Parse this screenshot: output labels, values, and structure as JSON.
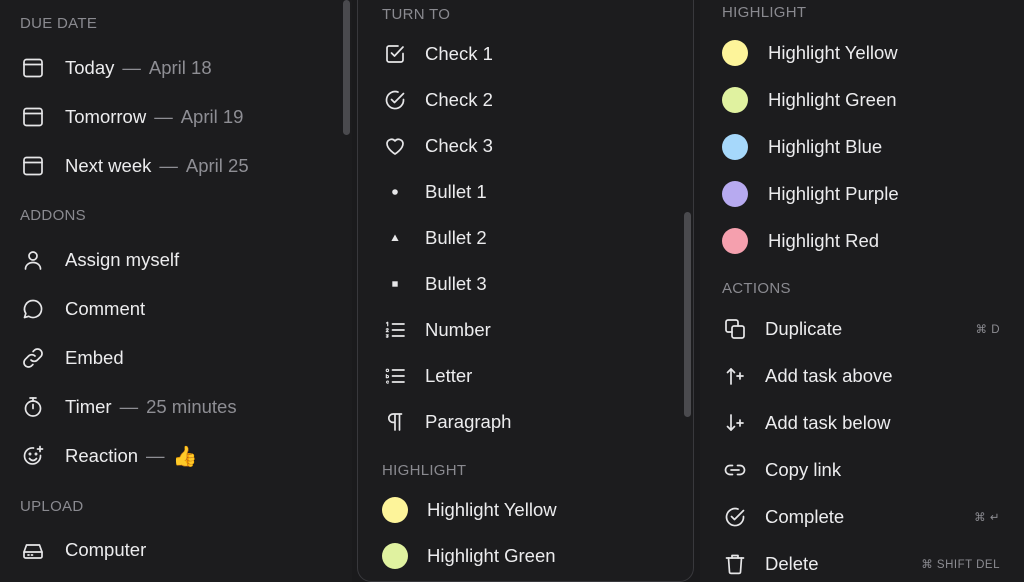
{
  "left": {
    "due_header": "DUE DATE",
    "due": [
      {
        "label": "Today",
        "date": "April 18",
        "icon": "calendar-icon"
      },
      {
        "label": "Tomorrow",
        "date": "April 19",
        "icon": "calendar-icon"
      },
      {
        "label": "Next week",
        "date": "April 25",
        "icon": "calendar-icon"
      }
    ],
    "addons_header": "ADDONS",
    "addons": [
      {
        "label": "Assign myself",
        "icon": "person-icon"
      },
      {
        "label": "Comment",
        "icon": "comment-icon"
      },
      {
        "label": "Embed",
        "icon": "link-icon"
      },
      {
        "label": "Timer",
        "sub": "25 minutes",
        "icon": "stopwatch-icon"
      },
      {
        "label": "Reaction",
        "emoji": "👍",
        "icon": "smiley-add-icon"
      }
    ],
    "upload_header": "UPLOAD",
    "upload": [
      {
        "label": "Computer",
        "icon": "drive-icon"
      }
    ],
    "dash": "—"
  },
  "middle": {
    "turn_header": "TURN TO",
    "turn": [
      {
        "label": "Check 1",
        "icon": "checkbox-icon"
      },
      {
        "label": "Check 2",
        "icon": "check-circle-icon"
      },
      {
        "label": "Check 3",
        "icon": "heart-icon"
      },
      {
        "label": "Bullet 1",
        "icon": "bullet-circle-icon"
      },
      {
        "label": "Bullet 2",
        "icon": "bullet-triangle-icon"
      },
      {
        "label": "Bullet 3",
        "icon": "bullet-square-icon"
      },
      {
        "label": "Number",
        "icon": "numbered-list-icon"
      },
      {
        "label": "Letter",
        "icon": "lettered-list-icon"
      },
      {
        "label": "Paragraph",
        "icon": "pilcrow-icon"
      }
    ],
    "highlight_header": "HIGHLIGHT",
    "highlight": [
      {
        "label": "Highlight Yellow",
        "color": "#fdf49a"
      },
      {
        "label": "Highlight Green",
        "color": "#e0f2a0"
      }
    ]
  },
  "right": {
    "highlight_header": "HIGHLIGHT",
    "highlight": [
      {
        "label": "Highlight Yellow",
        "color": "#fdf49a"
      },
      {
        "label": "Highlight Green",
        "color": "#e0f2a0"
      },
      {
        "label": "Highlight Blue",
        "color": "#a6d8fb"
      },
      {
        "label": "Highlight Purple",
        "color": "#b7aaf0"
      },
      {
        "label": "Highlight Red",
        "color": "#f5a0ae"
      }
    ],
    "actions_header": "ACTIONS",
    "actions": [
      {
        "label": "Duplicate",
        "icon": "duplicate-icon",
        "shortcut": "⌘ D"
      },
      {
        "label": "Add task above",
        "icon": "arrow-up-plus-icon",
        "shortcut": ""
      },
      {
        "label": "Add task below",
        "icon": "arrow-down-plus-icon",
        "shortcut": ""
      },
      {
        "label": "Copy link",
        "icon": "link-icon",
        "shortcut": ""
      },
      {
        "label": "Complete",
        "icon": "check-circle-icon",
        "shortcut": "⌘ ↵"
      },
      {
        "label": "Delete",
        "icon": "trash-icon",
        "shortcut": "⌘ SHIFT DEL"
      }
    ]
  }
}
